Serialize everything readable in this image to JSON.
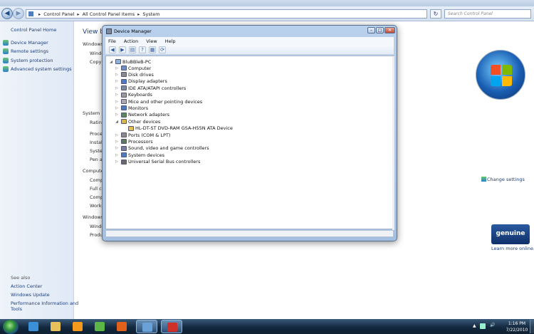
{
  "explorer": {
    "breadcrumb": [
      "Control Panel",
      "All Control Panel Items",
      "System"
    ],
    "search_placeholder": "Search Control Panel"
  },
  "sidebar": {
    "home_link": "Control Panel Home",
    "tasks": [
      {
        "label": "Device Manager",
        "icon": "shield-icon"
      },
      {
        "label": "Remote settings",
        "icon": "shield-icon"
      },
      {
        "label": "System protection",
        "icon": "shield-icon"
      },
      {
        "label": "Advanced system settings",
        "icon": "shield-icon"
      }
    ],
    "see_also_heading": "See also",
    "see_also": [
      "Action Center",
      "Windows Update",
      "Performance Information and",
      "Tools"
    ]
  },
  "content": {
    "view_basic": "View ba",
    "section_windows": "Windows",
    "windows_lines": [
      "Windo",
      "Copyr"
    ],
    "section_system": "System",
    "system_lines": [
      "Rating",
      "Proces",
      "Installe",
      "System",
      "Pen an"
    ],
    "section_computer": "Computer",
    "computer_lines": [
      "Comp",
      "Full co",
      "Comp",
      "Workg"
    ],
    "change_settings": "Change settings",
    "section_activation": "Windows",
    "activation_lines": [
      "Windo",
      "Produ"
    ],
    "genuine_badge": "genuine",
    "learn_more": "Learn more online..."
  },
  "device_manager": {
    "title": "Device Manager",
    "menu": [
      "File",
      "Action",
      "View",
      "Help"
    ],
    "root": "BluBBleB-PC",
    "items": [
      {
        "label": "Computer",
        "color": "#6b8fc4",
        "expanded": false,
        "indent": 1
      },
      {
        "label": "Disk drives",
        "color": "#8a8a8a",
        "expanded": false,
        "indent": 1
      },
      {
        "label": "Display adapters",
        "color": "#4d7bc2",
        "expanded": false,
        "indent": 1
      },
      {
        "label": "IDE ATA/ATAPI controllers",
        "color": "#7a8a9a",
        "expanded": false,
        "indent": 1
      },
      {
        "label": "Keyboards",
        "color": "#9a9a9a",
        "expanded": false,
        "indent": 1
      },
      {
        "label": "Mice and other pointing devices",
        "color": "#aaaaaa",
        "expanded": false,
        "indent": 1
      },
      {
        "label": "Monitors",
        "color": "#4d7bc2",
        "expanded": false,
        "indent": 1
      },
      {
        "label": "Network adapters",
        "color": "#5a8a5a",
        "expanded": false,
        "indent": 1
      },
      {
        "label": "Other devices",
        "color": "#d9b54a",
        "expanded": true,
        "indent": 1
      },
      {
        "label": "HL-DT-ST DVD-RAM GSA-H55N ATA Device",
        "color": "#e0c050",
        "expanded": null,
        "indent": 2
      },
      {
        "label": "Ports (COM & LPT)",
        "color": "#8a8a8a",
        "expanded": false,
        "indent": 1
      },
      {
        "label": "Processors",
        "color": "#5a7a5a",
        "expanded": false,
        "indent": 1
      },
      {
        "label": "Sound, video and game controllers",
        "color": "#7a7a9a",
        "expanded": false,
        "indent": 1
      },
      {
        "label": "System devices",
        "color": "#4d7bc2",
        "expanded": false,
        "indent": 1
      },
      {
        "label": "Universal Serial Bus controllers",
        "color": "#6a6a6a",
        "expanded": false,
        "indent": 1
      }
    ]
  },
  "taskbar": {
    "apps": [
      {
        "name": "internet-explorer-icon",
        "color": "#3b8fd6",
        "active": false
      },
      {
        "name": "folder-icon",
        "color": "#e8c15a",
        "active": false
      },
      {
        "name": "media-player-icon",
        "color": "#f39a1c",
        "active": false
      },
      {
        "name": "utorrent-icon",
        "color": "#5bb548",
        "active": false
      },
      {
        "name": "firefox-icon",
        "color": "#e0601c",
        "active": false
      },
      {
        "name": "control-panel-icon",
        "color": "#6aa2d8",
        "active": true
      },
      {
        "name": "device-manager-icon",
        "color": "#d0302a",
        "active": true
      }
    ],
    "clock_time": "1:16 PM",
    "clock_date": "7/22/2010"
  }
}
